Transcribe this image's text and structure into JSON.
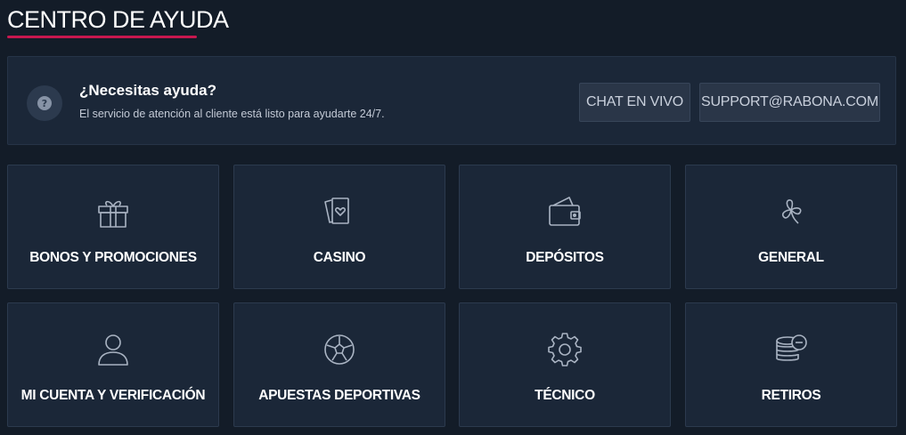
{
  "page": {
    "title": "CENTRO DE AYUDA"
  },
  "help_banner": {
    "heading": "¿Necesitas ayuda?",
    "subtext": "El servicio de atención al cliente está listo para ayudarte 24/7.",
    "icon": "question-circle-icon",
    "chat_label": "CHAT EN VIVO",
    "email_label": "SUPPORT@RABONA.COM"
  },
  "colors": {
    "background": "#131c28",
    "panel": "#1b2738",
    "accent_underline": "#c8174f",
    "icon_stroke": "#aab4c3"
  },
  "categories": [
    {
      "label": "BONOS Y PROMOCIONES",
      "icon": "gift-icon"
    },
    {
      "label": "CASINO",
      "icon": "playing-cards-icon"
    },
    {
      "label": "DEPÓSITOS",
      "icon": "wallet-icon"
    },
    {
      "label": "GENERAL",
      "icon": "clover-icon"
    },
    {
      "label": "MI CUENTA Y VERIFICACIÓN",
      "icon": "user-icon"
    },
    {
      "label": "APUESTAS DEPORTIVAS",
      "icon": "soccer-ball-icon"
    },
    {
      "label": "TÉCNICO",
      "icon": "gear-icon"
    },
    {
      "label": "RETIROS",
      "icon": "coins-withdraw-icon"
    }
  ]
}
